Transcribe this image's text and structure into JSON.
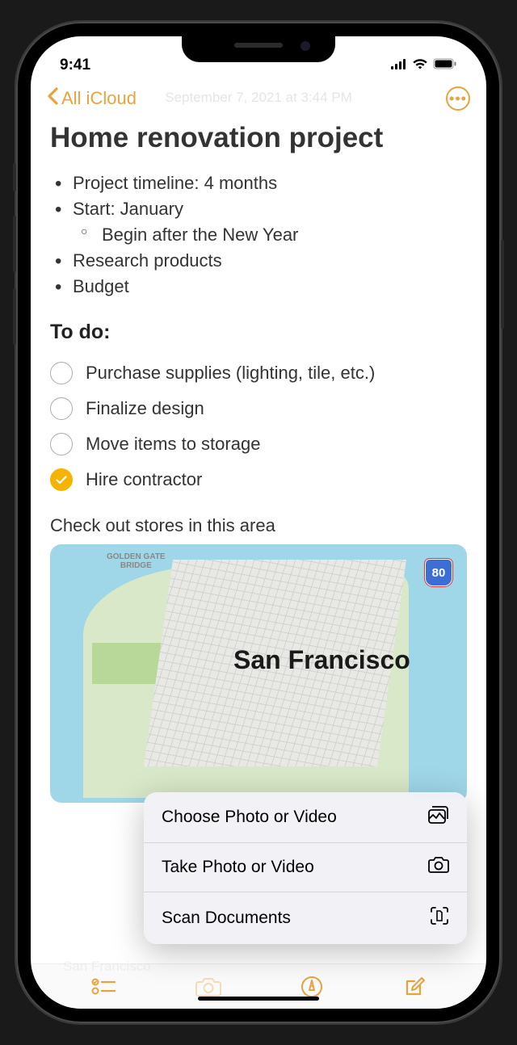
{
  "statusBar": {
    "time": "9:41"
  },
  "nav": {
    "backLabel": "All iCloud",
    "ghostDate": "September 7, 2021 at 3:44 PM"
  },
  "note": {
    "title": "Home renovation project",
    "bullets": [
      {
        "text": "Project timeline: 4 months",
        "level": 0
      },
      {
        "text": "Start: January",
        "level": 0
      },
      {
        "text": "Begin after the New Year",
        "level": 1
      },
      {
        "text": "Research products",
        "level": 0
      },
      {
        "text": "Budget",
        "level": 0
      }
    ],
    "todoHeading": "To do:",
    "todos": [
      {
        "text": "Purchase supplies (lighting, tile, etc.)",
        "checked": false
      },
      {
        "text": "Finalize design",
        "checked": false
      },
      {
        "text": "Move items to storage",
        "checked": false
      },
      {
        "text": "Hire contractor",
        "checked": true
      }
    ],
    "caption": "Check out stores in this area"
  },
  "map": {
    "bridgeLabel": "GOLDEN GATE\nBRIDGE",
    "highway": "80",
    "cityName": "San Francisco"
  },
  "actionMenu": {
    "items": [
      {
        "label": "Choose Photo or Video"
      },
      {
        "label": "Take Photo or Video"
      },
      {
        "label": "Scan Documents"
      }
    ]
  },
  "ghostFooter": "San Francisco"
}
